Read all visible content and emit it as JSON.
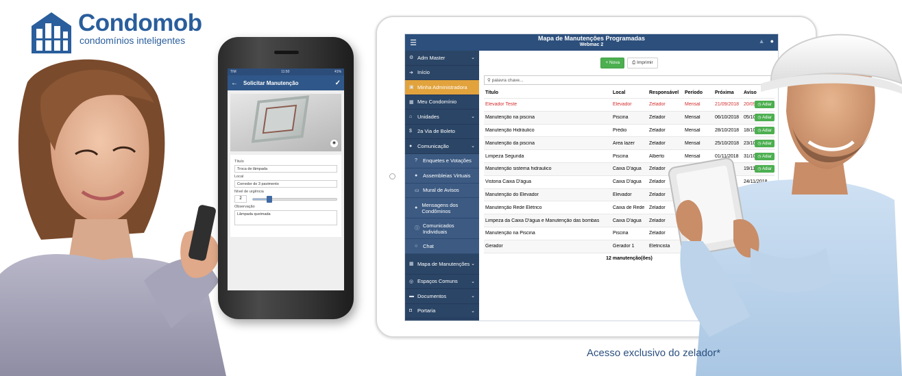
{
  "brand": {
    "name": "Condomob",
    "tagline": "condomínios inteligentes",
    "color": "#2a5e9c"
  },
  "phone": {
    "status": {
      "carrier": "TIM",
      "time": "11:50",
      "battery": "41%"
    },
    "screen_title": "Solicitar Manutenção",
    "form": {
      "titulo_label": "Título",
      "titulo_value": "Troca de lâmpada",
      "local_label": "Local",
      "local_value": "Corredor do 3 pavimento",
      "urgencia_label": "Nível de urgência",
      "urgencia_value": "2",
      "urgencia_level": 0.2,
      "observacao_label": "Observação",
      "observacao_value": "Lâmpada queimada"
    }
  },
  "tablet": {
    "title": "Mapa de Manutenções Programadas",
    "subtitle": "Webmac 2",
    "sidebar": [
      {
        "label": "Adm Master",
        "icon": "gears-icon",
        "chevron": true
      },
      {
        "label": "Início",
        "icon": "sign-in-icon"
      },
      {
        "label": "Minha Administradora",
        "icon": "briefcase-icon",
        "active": true
      },
      {
        "label": "Meu Condomínio",
        "icon": "building-icon"
      },
      {
        "label": "Unidades",
        "icon": "home-icon",
        "chevron": true
      },
      {
        "label": "2a Via de Boleto",
        "icon": "dollar-icon"
      },
      {
        "label": "Comunicação",
        "icon": "comments-icon",
        "chevron": true
      },
      {
        "label": "Enquetes e Votações",
        "icon": "question-icon",
        "sub": true
      },
      {
        "label": "Assembleias Virtuais",
        "icon": "comment-icon",
        "sub": true
      },
      {
        "label": "Mural de Avisos",
        "icon": "board-icon",
        "sub": true
      },
      {
        "label": "Mensagens dos Condôminos",
        "icon": "message-icon",
        "sub": true,
        "tall": true
      },
      {
        "label": "Comunicados Individuais",
        "icon": "info-icon",
        "sub": true,
        "tall": true
      },
      {
        "label": "Chat",
        "icon": "chat-icon",
        "sub": true
      },
      {
        "label": "Mapa de Manutenções",
        "icon": "grid-icon",
        "chevron": true,
        "tall": true
      },
      {
        "label": "Espaços Comuns",
        "icon": "circle-icon",
        "chevron": true
      },
      {
        "label": "Documentos",
        "icon": "folder-icon",
        "chevron": true
      },
      {
        "label": "Portaria",
        "icon": "shield-icon",
        "chevron": true
      }
    ],
    "buttons": {
      "new": "+ Nova",
      "print": "Imprimir"
    },
    "search_placeholder": "palavra chave...",
    "columns": [
      "Título",
      "Local",
      "Responsável",
      "Período",
      "Próxima",
      "Aviso"
    ],
    "rows": [
      {
        "titulo": "Elevador Teste",
        "local": "Elevador",
        "resp": "Zelador",
        "periodo": "Mensal",
        "proxima": "21/09/2018",
        "aviso": "20/09/2018",
        "overdue": true,
        "adiar": true
      },
      {
        "titulo": "Manutenção na piscina",
        "local": "Piscina",
        "resp": "Zelador",
        "periodo": "Mensal",
        "proxima": "06/10/2018",
        "aviso": "05/10/2018",
        "adiar": true
      },
      {
        "titulo": "Manutenção Hidráulico",
        "local": "Prédio",
        "resp": "Zelador",
        "periodo": "Mensal",
        "proxima": "28/10/2018",
        "aviso": "18/10/2018",
        "adiar": true
      },
      {
        "titulo": "Manutenção da piscina",
        "local": "Área lazer",
        "resp": "Zelador",
        "periodo": "Mensal",
        "proxima": "25/10/2018",
        "aviso": "23/10/2018",
        "adiar": true
      },
      {
        "titulo": "Limpeza Segunda",
        "local": "Piscina",
        "resp": "Alberto",
        "periodo": "Mensal",
        "proxima": "01/11/2018",
        "aviso": "31/10/2018",
        "adiar": true
      },
      {
        "titulo": "Manutenção sistema hidraulico",
        "local": "Caixa D'água",
        "resp": "Zelador",
        "periodo": "",
        "proxima": "1/2018",
        "aviso": "19/11/2018",
        "adiar": true
      },
      {
        "titulo": "Vistoria Caixa D'água",
        "local": "Caixa D'água",
        "resp": "Zelador",
        "periodo": "",
        "proxima": "2018",
        "aviso": "24/11/2018",
        "adiar": false
      },
      {
        "titulo": "Manutenção do Elevador",
        "local": "Elevador",
        "resp": "Zelador",
        "periodo": "",
        "proxima": "",
        "aviso": "",
        "adiar": false
      },
      {
        "titulo": "Manutenção Rede Elétrico",
        "local": "Caixa de Rede",
        "resp": "Zelador",
        "periodo": "",
        "proxima": "",
        "aviso": "",
        "adiar": false
      },
      {
        "titulo": "Limpeza da Caixa D'água e Manutenção das bombas",
        "local": "Caixa D'água",
        "resp": "Zelador",
        "periodo": "",
        "proxima": "",
        "aviso": "",
        "adiar": false
      },
      {
        "titulo": "Manutenção na Piscina",
        "local": "Piscina",
        "resp": "Zelador",
        "periodo": "",
        "proxima": "",
        "aviso": "",
        "adiar": false
      },
      {
        "titulo": "Gerador",
        "local": "Gerador 1",
        "resp": "Eletricista",
        "periodo": "",
        "proxima": "",
        "aviso": "",
        "adiar": false
      }
    ],
    "adiar_label": "Adiar",
    "footer": "12 manutenção(ões)"
  },
  "caption": "Acesso exclusivo do zelador*"
}
